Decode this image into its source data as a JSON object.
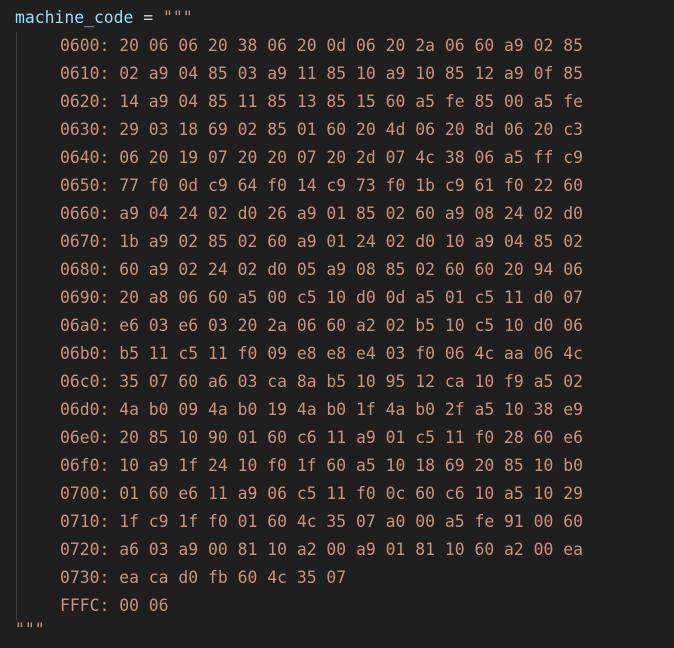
{
  "code": {
    "variable": "machine_code",
    "operator": "=",
    "open_quote": "\"\"\"",
    "close_quote": "\"\"\"",
    "lines": [
      "0600: 20 06 06 20 38 06 20 0d 06 20 2a 06 60 a9 02 85",
      "0610: 02 a9 04 85 03 a9 11 85 10 a9 10 85 12 a9 0f 85",
      "0620: 14 a9 04 85 11 85 13 85 15 60 a5 fe 85 00 a5 fe",
      "0630: 29 03 18 69 02 85 01 60 20 4d 06 20 8d 06 20 c3",
      "0640: 06 20 19 07 20 20 07 20 2d 07 4c 38 06 a5 ff c9",
      "0650: 77 f0 0d c9 64 f0 14 c9 73 f0 1b c9 61 f0 22 60",
      "0660: a9 04 24 02 d0 26 a9 01 85 02 60 a9 08 24 02 d0",
      "0670: 1b a9 02 85 02 60 a9 01 24 02 d0 10 a9 04 85 02",
      "0680: 60 a9 02 24 02 d0 05 a9 08 85 02 60 60 20 94 06",
      "0690: 20 a8 06 60 a5 00 c5 10 d0 0d a5 01 c5 11 d0 07",
      "06a0: e6 03 e6 03 20 2a 06 60 a2 02 b5 10 c5 10 d0 06",
      "06b0: b5 11 c5 11 f0 09 e8 e8 e4 03 f0 06 4c aa 06 4c",
      "06c0: 35 07 60 a6 03 ca 8a b5 10 95 12 ca 10 f9 a5 02",
      "06d0: 4a b0 09 4a b0 19 4a b0 1f 4a b0 2f a5 10 38 e9",
      "06e0: 20 85 10 90 01 60 c6 11 a9 01 c5 11 f0 28 60 e6",
      "06f0: 10 a9 1f 24 10 f0 1f 60 a5 10 18 69 20 85 10 b0",
      "0700: 01 60 e6 11 a9 06 c5 11 f0 0c 60 c6 10 a5 10 29",
      "0710: 1f c9 1f f0 01 60 4c 35 07 a0 00 a5 fe 91 00 60",
      "0720: a6 03 a9 00 81 10 a2 00 a9 01 81 10 60 a2 00 ea",
      "0730: ea ca d0 fb 60 4c 35 07",
      "FFFC: 00 06"
    ]
  },
  "colors": {
    "background": "#1f1f1f",
    "variable": "#9cdcfe",
    "operator": "#d4d4d4",
    "string": "#ce9178"
  }
}
